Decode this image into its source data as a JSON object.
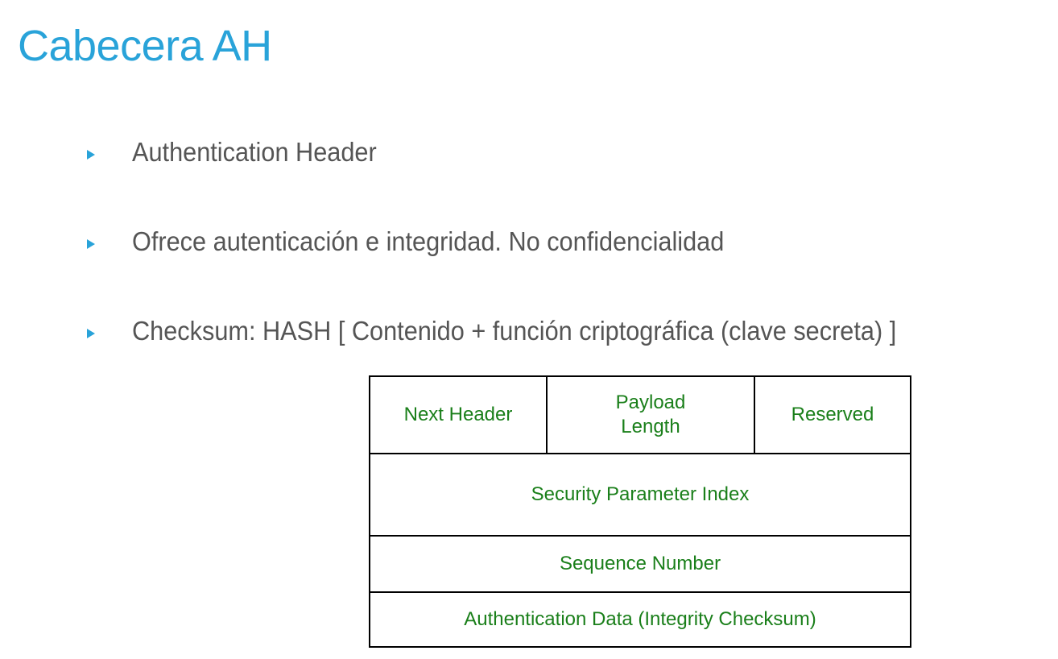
{
  "slide": {
    "title": "Cabecera AH"
  },
  "bullets": [
    {
      "text": "Authentication Header"
    },
    {
      "text": "Ofrece autenticación e integridad. No confidencialidad"
    },
    {
      "text": "Checksum: HASH [ Contenido + función criptográfica (clave secreta) ]"
    }
  ],
  "ah_header": {
    "next_header": "Next Header",
    "payload_length": "Payload\nLength",
    "reserved": "Reserved",
    "spi": "Security Parameter Index",
    "sequence_number": "Sequence Number",
    "auth_data": "Authentication Data (Integrity Checksum)"
  },
  "colors": {
    "title": "#29a3d9",
    "bullet_marker": "#29a3d9",
    "bullet_text": "#555555",
    "field_text": "#1a7f1a",
    "border": "#000000"
  }
}
